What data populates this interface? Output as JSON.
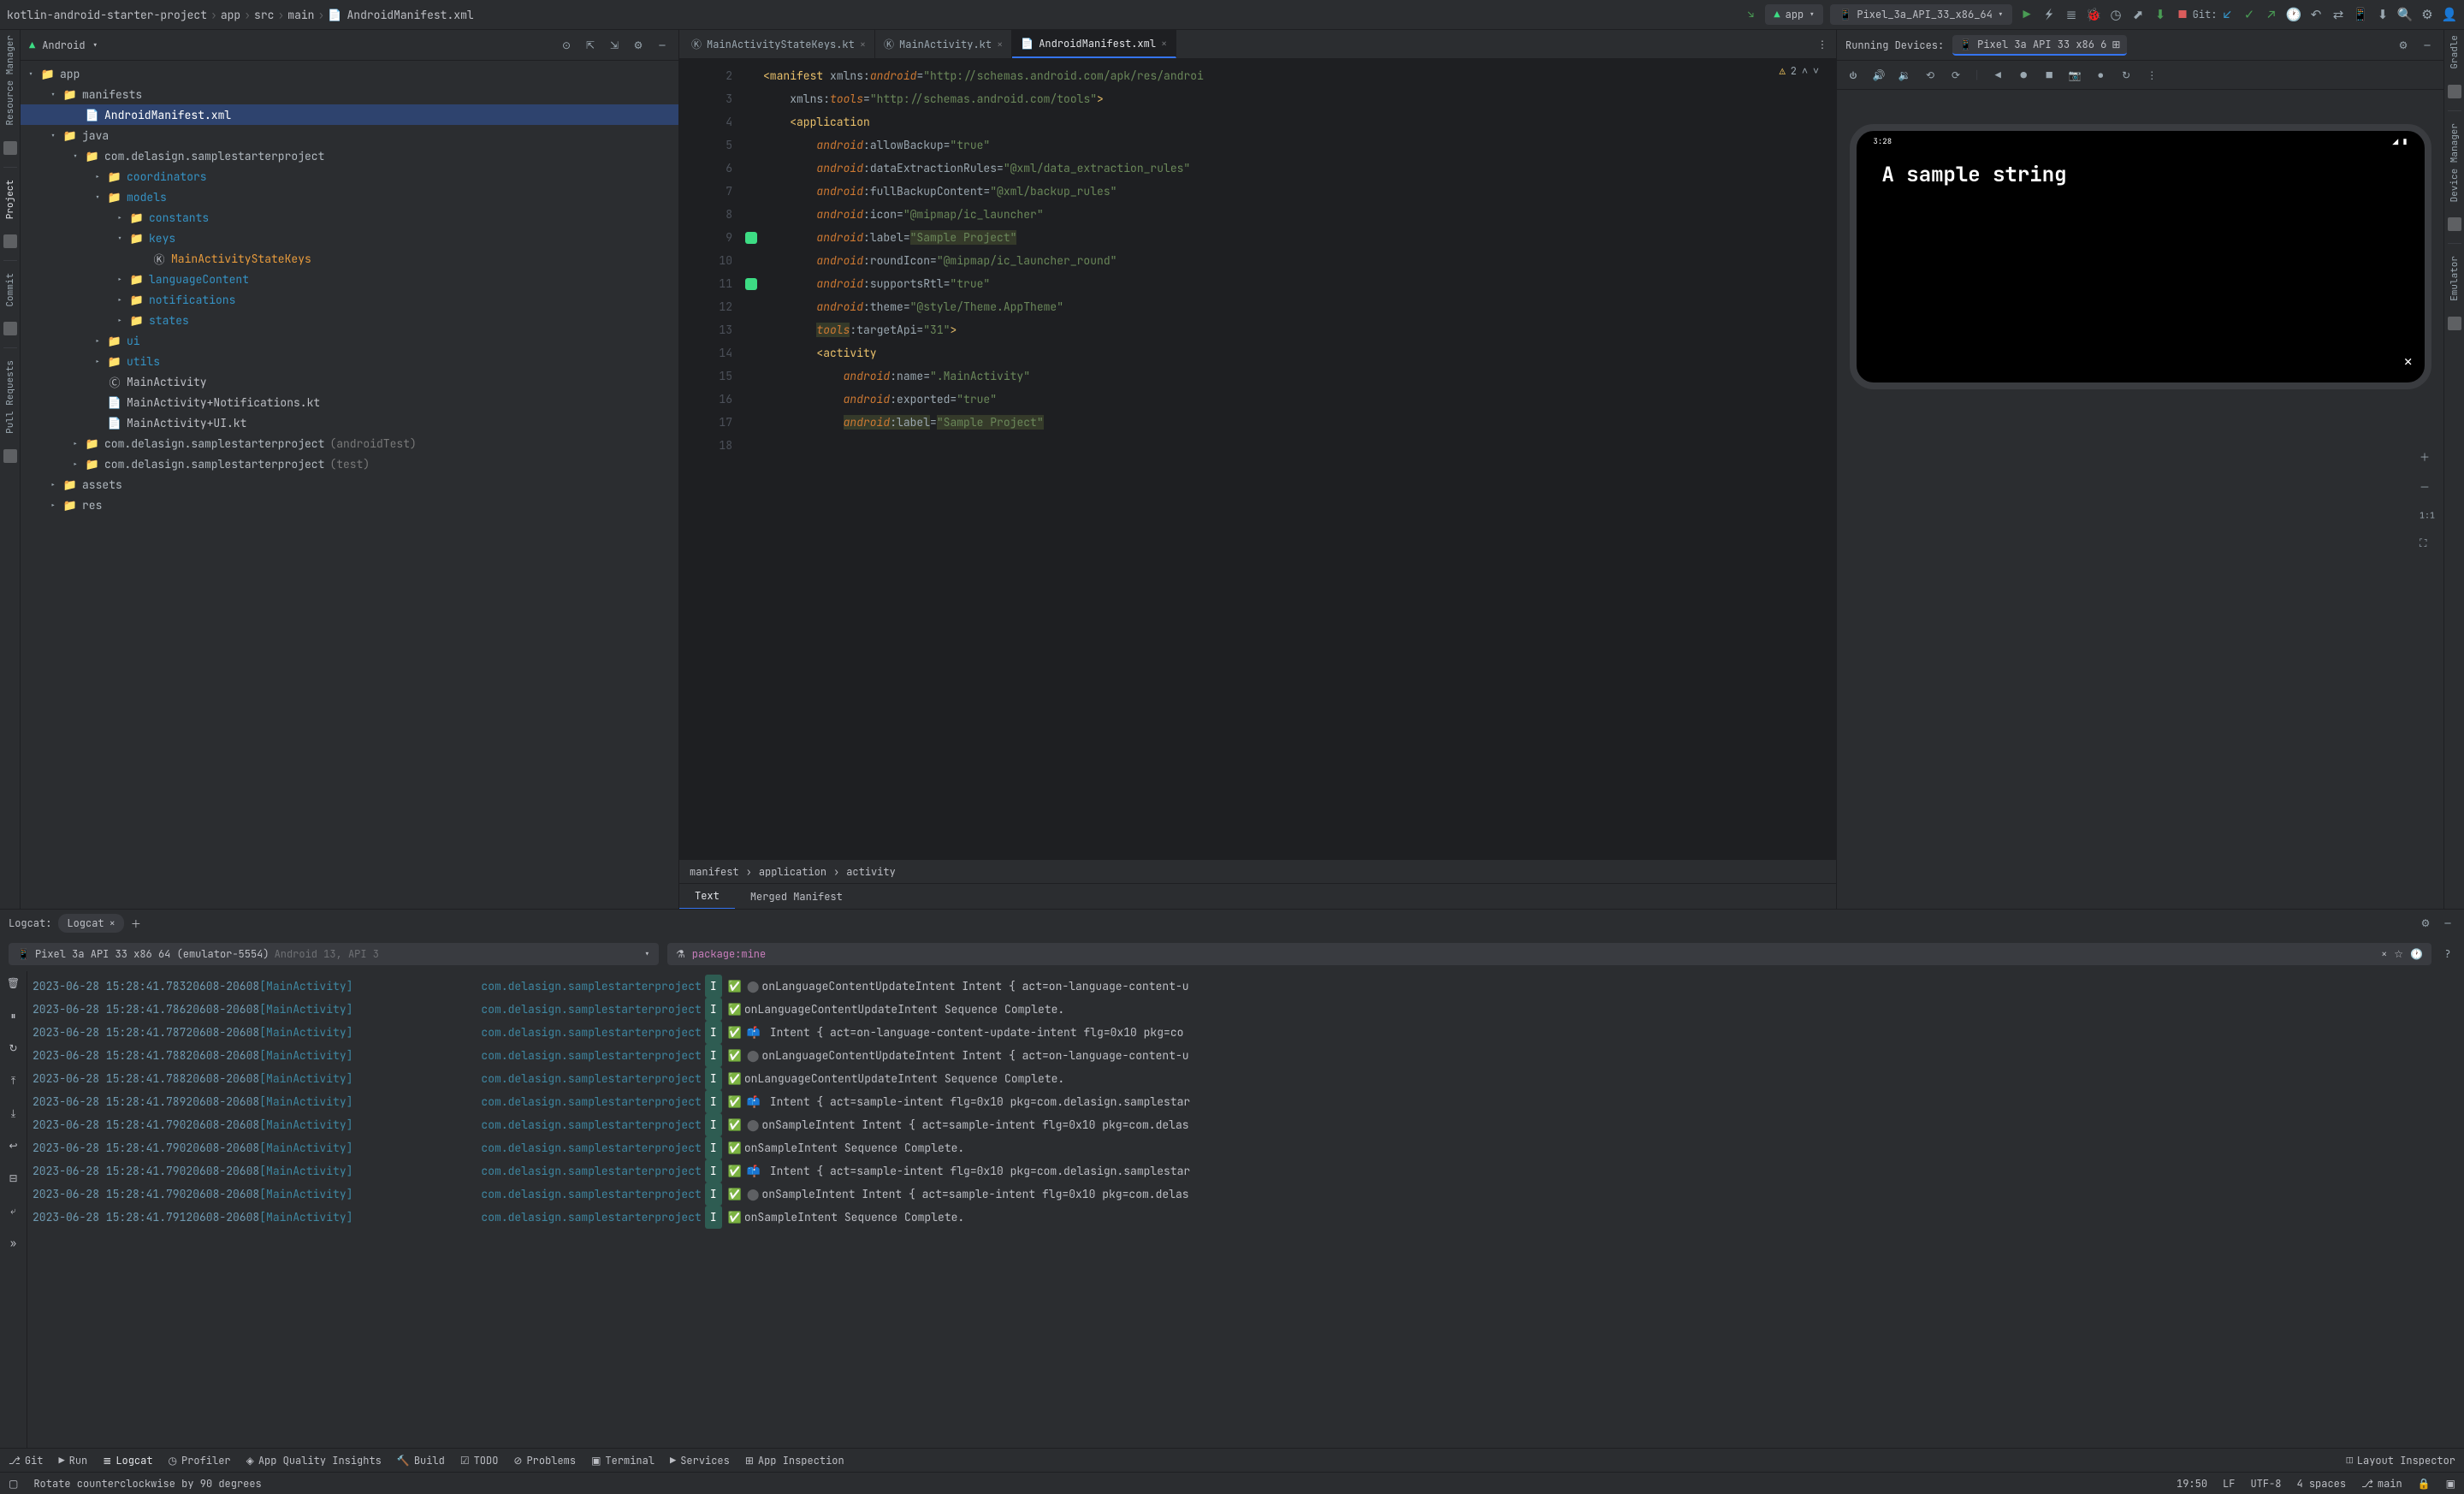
{
  "breadcrumb": [
    "kotlin-android-starter-project",
    "app",
    "src",
    "main",
    "AndroidManifest.xml"
  ],
  "runConfig": "app",
  "deviceSelect": "Pixel_3a_API_33_x86_64",
  "gitLabel": "Git:",
  "project": {
    "title": "Android",
    "tree": [
      {
        "depth": 0,
        "arrow": "▾",
        "icon": "📁",
        "label": "app",
        "cls": "folder"
      },
      {
        "depth": 1,
        "arrow": "▾",
        "icon": "📁",
        "label": "manifests",
        "cls": "folder"
      },
      {
        "depth": 2,
        "arrow": "",
        "icon": "📄",
        "label": "AndroidManifest.xml",
        "cls": "",
        "sel": true
      },
      {
        "depth": 1,
        "arrow": "▾",
        "icon": "📁",
        "label": "java",
        "cls": "folder"
      },
      {
        "depth": 2,
        "arrow": "▾",
        "icon": "📁",
        "label": "com.delasign.samplestarterproject",
        "cls": "folder"
      },
      {
        "depth": 3,
        "arrow": "▸",
        "icon": "📁",
        "label": "coordinators",
        "cls": "folder-teal"
      },
      {
        "depth": 3,
        "arrow": "▾",
        "icon": "📁",
        "label": "models",
        "cls": "folder-teal"
      },
      {
        "depth": 4,
        "arrow": "▸",
        "icon": "📁",
        "label": "constants",
        "cls": "folder-teal"
      },
      {
        "depth": 4,
        "arrow": "▾",
        "icon": "📁",
        "label": "keys",
        "cls": "folder-teal"
      },
      {
        "depth": 5,
        "arrow": "",
        "icon": "Ⓚ",
        "label": "MainActivityStateKeys",
        "cls": "orange-txt"
      },
      {
        "depth": 4,
        "arrow": "▸",
        "icon": "📁",
        "label": "languageContent",
        "cls": "folder-teal"
      },
      {
        "depth": 4,
        "arrow": "▸",
        "icon": "📁",
        "label": "notifications",
        "cls": "folder-teal"
      },
      {
        "depth": 4,
        "arrow": "▸",
        "icon": "📁",
        "label": "states",
        "cls": "folder-teal"
      },
      {
        "depth": 3,
        "arrow": "▸",
        "icon": "📁",
        "label": "ui",
        "cls": "folder-teal"
      },
      {
        "depth": 3,
        "arrow": "▸",
        "icon": "📁",
        "label": "utils",
        "cls": "folder-teal"
      },
      {
        "depth": 3,
        "arrow": "",
        "icon": "Ⓒ",
        "label": "MainActivity",
        "cls": ""
      },
      {
        "depth": 3,
        "arrow": "",
        "icon": "📄",
        "label": "MainActivity+Notifications.kt",
        "cls": ""
      },
      {
        "depth": 3,
        "arrow": "",
        "icon": "📄",
        "label": "MainActivity+UI.kt",
        "cls": ""
      },
      {
        "depth": 2,
        "arrow": "▸",
        "icon": "📁",
        "label": "com.delasign.samplestarterproject",
        "suffix": "(androidTest)",
        "cls": "folder"
      },
      {
        "depth": 2,
        "arrow": "▸",
        "icon": "📁",
        "label": "com.delasign.samplestarterproject",
        "suffix": "(test)",
        "cls": "folder"
      },
      {
        "depth": 1,
        "arrow": "▸",
        "icon": "📁",
        "label": "assets",
        "cls": "folder"
      },
      {
        "depth": 1,
        "arrow": "▸",
        "icon": "📁",
        "label": "res",
        "cls": "folder"
      }
    ]
  },
  "editorTabs": [
    {
      "name": "MainActivityStateKeys.kt",
      "icon": "Ⓚ",
      "active": false
    },
    {
      "name": "MainActivity.kt",
      "icon": "Ⓚ",
      "active": false
    },
    {
      "name": "AndroidManifest.xml",
      "icon": "📄",
      "active": true
    }
  ],
  "warningCount": "2",
  "code": {
    "lines": [
      2,
      3,
      4,
      5,
      6,
      7,
      8,
      9,
      10,
      11,
      12,
      13,
      14,
      15,
      16,
      17,
      18
    ],
    "content": [
      "<span class='tag'>&lt;manifest </span><span class='attr'>xmlns:</span><span class='ns'>android</span><span class='attr'>=</span><span class='val'>\"http://schemas.android.com/apk/res/androi</span>",
      "    <span class='attr'>xmlns:</span><span class='ns'>tools</span><span class='attr'>=</span><span class='val'>\"http://schemas.android.com/tools\"</span><span class='tag'>&gt;</span>",
      "",
      "    <span class='tag'>&lt;application</span>",
      "        <span class='ns'>android</span><span class='attr'>:allowBackup=</span><span class='val'>\"true\"</span>",
      "        <span class='ns'>android</span><span class='attr'>:dataExtractionRules=</span><span class='val'>\"@xml/data_extraction_rules\"</span>",
      "        <span class='ns'>android</span><span class='attr'>:fullBackupContent=</span><span class='val'>\"@xml/backup_rules\"</span>",
      "        <span class='ns'>android</span><span class='attr'>:icon=</span><span class='val'>\"@mipmap/ic_launcher\"</span>",
      "        <span class='ns'>android</span><span class='attr'>:label=</span><span class='val hl'>\"Sample Project\"</span>",
      "        <span class='ns'>android</span><span class='attr'>:roundIcon=</span><span class='val'>\"@mipmap/ic_launcher_round\"</span>",
      "        <span class='ns'>android</span><span class='attr'>:supportsRtl=</span><span class='val'>\"true\"</span>",
      "        <span class='ns'>android</span><span class='attr'>:theme=</span><span class='val'>\"@style/Theme.AppTheme\"</span>",
      "        <span class='ns hl'>tools</span><span class='attr'>:targetApi=</span><span class='val'>\"31\"</span><span class='tag'>&gt;</span>",
      "        <span class='tag'>&lt;activity</span>",
      "            <span class='ns'>android</span><span class='attr'>:name=</span><span class='val'>\".MainActivity\"</span>",
      "            <span class='ns'>android</span><span class='attr'>:exported=</span><span class='val'>\"true\"</span>",
      "            <span class='ns hl'>android</span><span class='attr hl'>:label</span><span class='attr'>=</span><span class='val hl'>\"Sample Project\"</span>"
    ]
  },
  "editorBC": [
    "manifest",
    "application",
    "activity"
  ],
  "subTabs": [
    {
      "name": "Text",
      "active": true
    },
    {
      "name": "Merged Manifest",
      "active": false
    }
  ],
  "devices": {
    "header": "Running Devices:",
    "selected": "Pixel 3a API 33 x86 6",
    "phoneTime": "3:28",
    "phoneText": "A sample string"
  },
  "logcat": {
    "tabTitle": "Logcat:",
    "tabName": "Logcat",
    "deviceText": "Pixel 3a API 33 x86 64 (emulator-5554)",
    "deviceSuffix": "Android 13, API 3",
    "filter": "package:mine",
    "rows": [
      {
        "ts": "2023-06-28 15:28:41.783",
        "pid": "20608-20608",
        "tag": "[MainActivity]",
        "pkg": "com.delasign.samplestarterproject",
        "lvl": "I",
        "emoji": "✅",
        "bullet": "⬤",
        "msg": "onLanguageContentUpdateIntent Intent { act=on-language-content-u"
      },
      {
        "ts": "2023-06-28 15:28:41.786",
        "pid": "20608-20608",
        "tag": "[MainActivity]",
        "pkg": "com.delasign.samplestarterproject",
        "lvl": "I",
        "emoji": "✅",
        "msg": "onLanguageContentUpdateIntent Sequence Complete."
      },
      {
        "ts": "2023-06-28 15:28:41.787",
        "pid": "20608-20608",
        "tag": "[MainActivity]",
        "pkg": "com.delasign.samplestarterproject",
        "lvl": "I",
        "emoji": "✅",
        "extra": "📫",
        "msg": " Intent { act=on-language-content-update-intent flg=0x10 pkg=co"
      },
      {
        "ts": "2023-06-28 15:28:41.788",
        "pid": "20608-20608",
        "tag": "[MainActivity]",
        "pkg": "com.delasign.samplestarterproject",
        "lvl": "I",
        "emoji": "✅",
        "bullet": "⬤",
        "msg": "onLanguageContentUpdateIntent Intent { act=on-language-content-u"
      },
      {
        "ts": "2023-06-28 15:28:41.788",
        "pid": "20608-20608",
        "tag": "[MainActivity]",
        "pkg": "com.delasign.samplestarterproject",
        "lvl": "I",
        "emoji": "✅",
        "msg": "onLanguageContentUpdateIntent Sequence Complete."
      },
      {
        "ts": "2023-06-28 15:28:41.789",
        "pid": "20608-20608",
        "tag": "[MainActivity]",
        "pkg": "com.delasign.samplestarterproject",
        "lvl": "I",
        "emoji": "✅",
        "extra": "📫",
        "msg": " Intent { act=sample-intent flg=0x10 pkg=com.delasign.samplestar"
      },
      {
        "ts": "2023-06-28 15:28:41.790",
        "pid": "20608-20608",
        "tag": "[MainActivity]",
        "pkg": "com.delasign.samplestarterproject",
        "lvl": "I",
        "emoji": "✅",
        "bullet": "⬤",
        "msg": "onSampleIntent Intent { act=sample-intent flg=0x10 pkg=com.delas"
      },
      {
        "ts": "2023-06-28 15:28:41.790",
        "pid": "20608-20608",
        "tag": "[MainActivity]",
        "pkg": "com.delasign.samplestarterproject",
        "lvl": "I",
        "emoji": "✅",
        "msg": "onSampleIntent Sequence Complete."
      },
      {
        "ts": "2023-06-28 15:28:41.790",
        "pid": "20608-20608",
        "tag": "[MainActivity]",
        "pkg": "com.delasign.samplestarterproject",
        "lvl": "I",
        "emoji": "✅",
        "extra": "📫",
        "msg": " Intent { act=sample-intent flg=0x10 pkg=com.delasign.samplestar"
      },
      {
        "ts": "2023-06-28 15:28:41.790",
        "pid": "20608-20608",
        "tag": "[MainActivity]",
        "pkg": "com.delasign.samplestarterproject",
        "lvl": "I",
        "emoji": "✅",
        "bullet": "⬤",
        "msg": "onSampleIntent Intent { act=sample-intent flg=0x10 pkg=com.delas"
      },
      {
        "ts": "2023-06-28 15:28:41.791",
        "pid": "20608-20608",
        "tag": "[MainActivity]",
        "pkg": "com.delasign.samplestarterproject",
        "lvl": "I",
        "emoji": "✅",
        "msg": "onSampleIntent Sequence Complete."
      }
    ]
  },
  "bottomItems": [
    {
      "icon": "⎇",
      "label": "Git"
    },
    {
      "icon": "▶",
      "label": "Run"
    },
    {
      "icon": "≣",
      "label": "Logcat",
      "active": true
    },
    {
      "icon": "◷",
      "label": "Profiler"
    },
    {
      "icon": "◈",
      "label": "App Quality Insights"
    },
    {
      "icon": "🔨",
      "label": "Build"
    },
    {
      "icon": "☑",
      "label": "TODO"
    },
    {
      "icon": "⊘",
      "label": "Problems"
    },
    {
      "icon": "▣",
      "label": "Terminal"
    },
    {
      "icon": "▶",
      "label": "Services"
    },
    {
      "icon": "⊞",
      "label": "App Inspection"
    }
  ],
  "layoutInspector": "Layout Inspector",
  "statusMsg": "Rotate counterclockwise by 90 degrees",
  "statusRight": [
    "19:50",
    "LF",
    "UTF-8",
    "4 spaces",
    "main"
  ],
  "leftRailItems": [
    "Resource Manager",
    "Project",
    "Commit",
    "Pull Requests"
  ],
  "rightRailItems": [
    "Gradle",
    "Device Manager",
    "Emulator"
  ]
}
